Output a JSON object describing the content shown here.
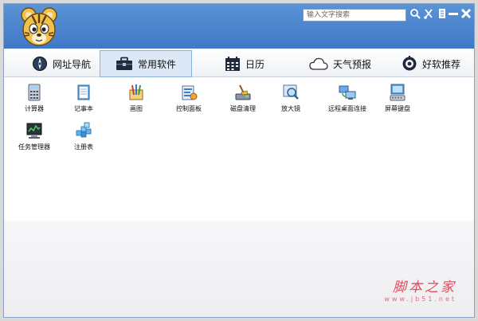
{
  "header": {
    "search_placeholder": "输入文字搜索",
    "icons": [
      "search-icon",
      "skin-icon",
      "feedback-icon",
      "minimize-icon",
      "close-icon"
    ]
  },
  "tabs": [
    {
      "label": "网址导航",
      "icon": "compass-icon",
      "active": false
    },
    {
      "label": "常用软件",
      "icon": "toolbox-icon",
      "active": true
    },
    {
      "label": "日历",
      "icon": "calendar-icon",
      "active": false
    },
    {
      "label": "天气预报",
      "icon": "cloud-icon",
      "active": false
    },
    {
      "label": "好软推荐",
      "icon": "recommend-icon",
      "active": false
    }
  ],
  "apps": [
    {
      "label": "计算器",
      "icon": "calculator-icon"
    },
    {
      "label": "记事本",
      "icon": "notepad-icon"
    },
    {
      "label": "画图",
      "icon": "paint-icon"
    },
    {
      "label": "控制面板",
      "icon": "control-panel-icon"
    },
    {
      "label": "磁盘清理",
      "icon": "disk-cleanup-icon"
    },
    {
      "label": "放大镜",
      "icon": "magnifier-icon"
    },
    {
      "label": "远程桌面连接",
      "icon": "remote-desktop-icon"
    },
    {
      "label": "屏幕键盘",
      "icon": "on-screen-keyboard-icon"
    },
    {
      "label": "任务管理器",
      "icon": "task-manager-icon"
    },
    {
      "label": "注册表",
      "icon": "registry-icon"
    }
  ],
  "watermark": {
    "text": "脚本之家",
    "url": "www.jb51.net"
  },
  "colors": {
    "header": "#4a86cf",
    "active_tab": "#dce8f6",
    "watermark": "#e04a5e"
  }
}
